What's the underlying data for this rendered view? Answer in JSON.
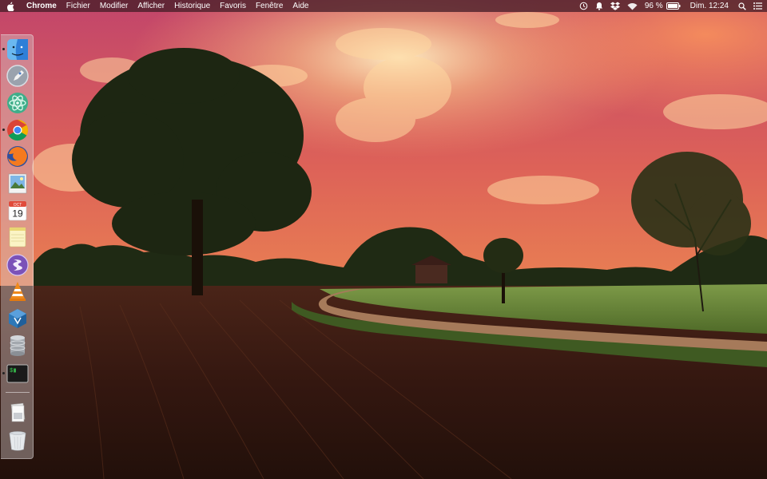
{
  "menubar": {
    "app_name": "Chrome",
    "menus": [
      "Fichier",
      "Modifier",
      "Afficher",
      "Historique",
      "Favoris",
      "Fenêtre",
      "Aide"
    ],
    "status": {
      "battery_percent": "96 %",
      "clock": "Dim. 12:24",
      "icons": [
        "timemachine-icon",
        "notification-icon",
        "dropbox-icon",
        "wifi-icon",
        "battery-icon",
        "spotlight-icon",
        "notification-center-icon"
      ]
    }
  },
  "dock": {
    "items": [
      {
        "name": "finder",
        "running": true
      },
      {
        "name": "launchpad",
        "running": false
      },
      {
        "name": "atom",
        "running": false
      },
      {
        "name": "chrome",
        "running": true
      },
      {
        "name": "firefox",
        "running": false
      },
      {
        "name": "preview",
        "running": false
      },
      {
        "name": "calendar",
        "running": false,
        "month": "OCT",
        "day": "19"
      },
      {
        "name": "notes",
        "running": false
      },
      {
        "name": "emacs",
        "running": false
      },
      {
        "name": "vlc",
        "running": false
      },
      {
        "name": "virtualbox",
        "running": false
      },
      {
        "name": "database",
        "running": false
      },
      {
        "name": "terminal",
        "running": true,
        "prompt": "$"
      },
      {
        "name": "documents",
        "running": false
      },
      {
        "name": "trash",
        "running": false
      }
    ]
  },
  "colors": {
    "sky_top": "#c94a6a",
    "sky_mid": "#e2734f",
    "horizon": "#f3a35a",
    "field": "#3a1c12",
    "grass": "#6f8e3c",
    "menubar": "#4a2230"
  }
}
